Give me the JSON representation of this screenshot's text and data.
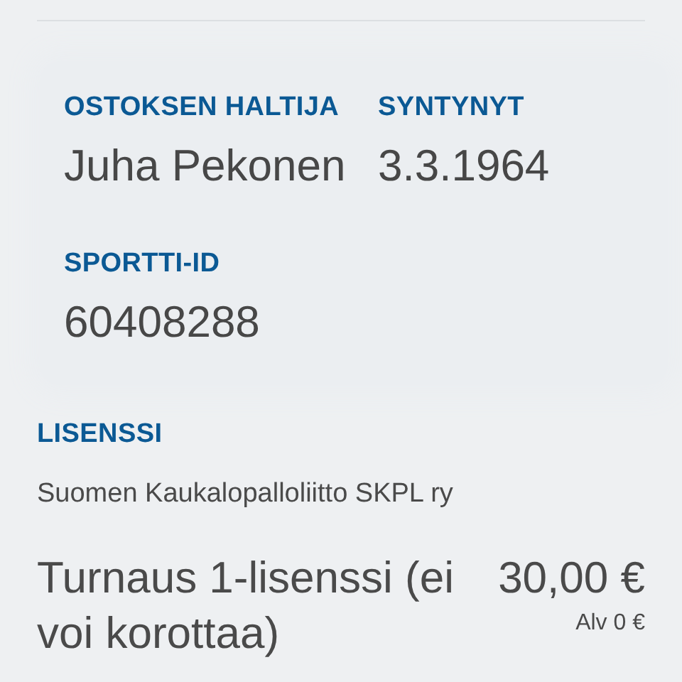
{
  "holder": {
    "fields": [
      {
        "label": "OSTOKSEN HALTIJA",
        "value": "Juha Pekonen"
      },
      {
        "label": "SYNTYNYT",
        "value": "3.3.1964"
      },
      {
        "label": "SPORTTI-ID",
        "value": "60408288"
      }
    ]
  },
  "license": {
    "label": "LISENSSI",
    "organization": "Suomen Kaukalopalloliitto SKPL ry",
    "product": {
      "name": "Turnaus 1-lisenssi (ei voi korottaa)",
      "price": "30,00 €",
      "vat": "Alv 0 €"
    }
  }
}
